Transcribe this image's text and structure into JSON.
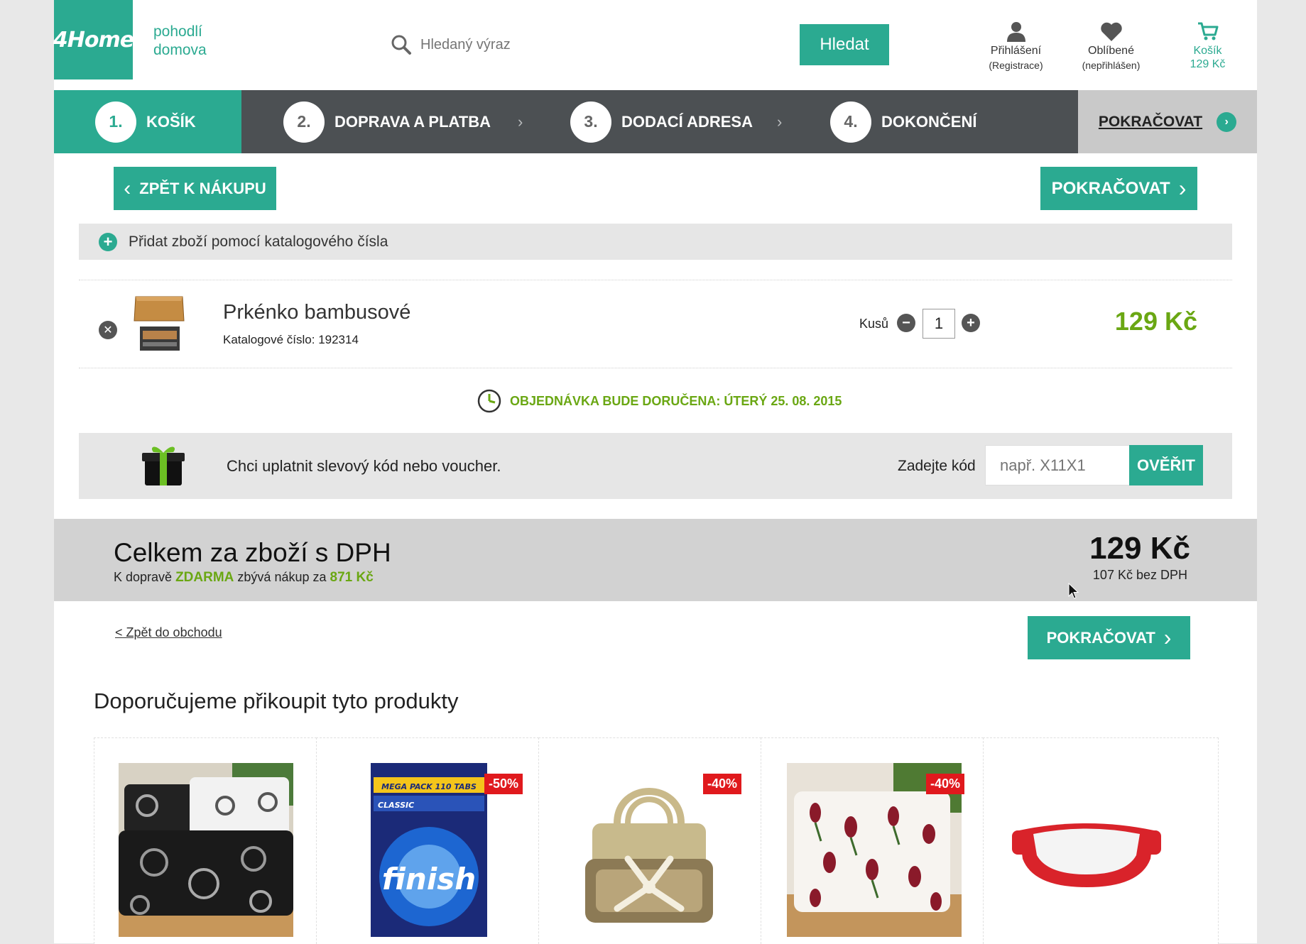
{
  "header": {
    "logo_text": "4Home",
    "tagline_line1": "pohodlí",
    "tagline_line2": "domova",
    "search_placeholder": "Hledaný výraz",
    "search_button": "Hledat",
    "login_label": "Přihlášení",
    "login_sub": "(Registrace)",
    "favorites_label": "Oblíbené",
    "favorites_sub": "(nepřihlášen)",
    "cart_label": "Košík",
    "cart_total": "129 Kč"
  },
  "steps": [
    {
      "num": "1.",
      "label": "KOŠÍK"
    },
    {
      "num": "2.",
      "label": "DOPRAVA A PLATBA"
    },
    {
      "num": "3.",
      "label": "DODACÍ ADRESA"
    },
    {
      "num": "4.",
      "label": "DOKONČENÍ"
    }
  ],
  "steps_continue": "POKRAČOVAT",
  "back_to_shopping": "ZPĚT K NÁKUPU",
  "continue_button": "POKRAČOVAT",
  "add_by_catalog": "Přidat zboží pomocí katalogového čísla",
  "cart_item": {
    "name": "Prkénko bambusové",
    "catalog_label": "Katalogové číslo: 192314",
    "qty_label": "Kusů",
    "qty": "1",
    "price": "129 Kč"
  },
  "delivery_text": "OBJEDNÁVKA BUDE DORUČENA: ÚTERÝ 25. 08. 2015",
  "voucher": {
    "text": "Chci uplatnit slevový kód nebo voucher.",
    "code_label": "Zadejte kód",
    "placeholder": "např. X11X1",
    "verify_button": "OVĚŘIT"
  },
  "total": {
    "title": "Celkem za zboží s DPH",
    "shipping_prefix": "K dopravě",
    "shipping_free": "ZDARMA",
    "shipping_middle": "zbývá nákup za",
    "shipping_remaining": "871 Kč",
    "amount": "129 Kč",
    "amount_no_vat": "107 Kč bez DPH"
  },
  "back_to_shop_link": "< Zpět do obchodu",
  "recommend_title": "Doporučujeme přikoupit tyto produkty",
  "recommended": [
    {
      "badge": ""
    },
    {
      "badge": "-50%",
      "pack_text": "MEGA PACK 110 TABS",
      "pack_sub": "CLASSIC",
      "brand": "finish"
    },
    {
      "badge": "-40%"
    },
    {
      "badge": "-40%"
    },
    {
      "badge": ""
    }
  ],
  "colors": {
    "brand": "#2baa91",
    "price_green": "#6aa713",
    "dark_bar": "#4c5053",
    "discount_red": "#e0191d"
  }
}
